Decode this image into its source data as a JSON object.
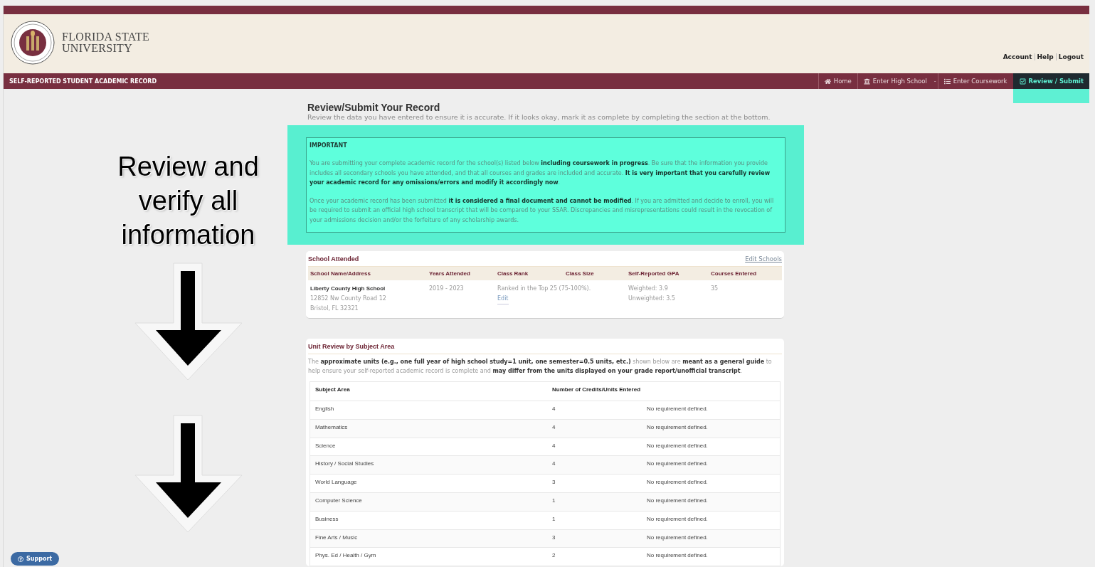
{
  "header": {
    "university_name": [
      "FLORIDA STATE",
      "UNIVERSITY"
    ],
    "user_links": [
      "Account",
      "Help",
      "Logout"
    ]
  },
  "nav": {
    "title": "SELF-REPORTED STUDENT ACADEMIC RECORD",
    "items": [
      {
        "kind": "tab",
        "label": "Home",
        "selected": false
      },
      {
        "kind": "tab",
        "label": "Enter High School",
        "selected": false
      },
      {
        "kind": "separator",
        "label": "-"
      },
      {
        "kind": "tab",
        "label": "Enter Coursework",
        "selected": false
      },
      {
        "kind": "tab",
        "label": "Review / Submit",
        "selected": true
      }
    ]
  },
  "annotation": {
    "text": "Review and verify all information"
  },
  "page": {
    "title": "Review/Submit Your Record",
    "subtitle": "Review the data you have entered to ensure it is accurate. If it looks okay, mark it as complete by completing the section at the bottom."
  },
  "important": {
    "heading": "IMPORTANT",
    "paragraphs": [
      "You are submitting your complete academic record for the school(s) listed below **including coursework in progress**. Be sure that the information you provide includes all secondary schools you have attended, and that all courses and grades are included and accurate. **It is very important that you carefully review your academic record for any omissions/errors and modify it accordingly now**.",
      "Once your academic record has been submitted **it is considered a final document and cannot be modified**. If you are admitted and decide to enroll, you will be required to submit an official high school transcript that will be compared to your SSAR. Discrepancies and misrepresentations could result in the revocation of your admissions decision and/or the forfeiture of any scholarship awards."
    ]
  },
  "school_attended": {
    "title": "School Attended",
    "edit_link": "Edit Schools",
    "columns": [
      "School Name/Address",
      "Years Attended",
      "Class Rank",
      "Class Size",
      "Self-Reported GPA",
      "Courses Entered"
    ],
    "rows": [
      {
        "name": "Liberty County High School",
        "address": [
          "12852 Nw County Road 12",
          "Bristol, FL 32321"
        ],
        "years": "2019 - 2023",
        "rank": "Ranked in the Top 25 (75-100%).",
        "rank_edit": "Edit",
        "gpa": [
          "Weighted: 3.9",
          "Unweighted: 3.5"
        ],
        "courses": "35"
      }
    ]
  },
  "unit_review": {
    "title": "Unit Review by Subject Area",
    "description": "The **approximate units (e.g., one full year of high school study=1 unit, one semester=0.5 units, etc.)** shown below are **meant as a general guide** to help ensure your self-reported academic record is complete and **may differ from the units displayed on your grade report/unofficial transcript**.",
    "columns": [
      "Subject Area",
      "Number of Credits/Units Entered"
    ],
    "rows": [
      {
        "subject": "English",
        "units": "4",
        "requirement": "No requirement defined."
      },
      {
        "subject": "Mathematics",
        "units": "4",
        "requirement": "No requirement defined."
      },
      {
        "subject": "Science",
        "units": "4",
        "requirement": "No requirement defined."
      },
      {
        "subject": "History / Social Studies",
        "units": "4",
        "requirement": "No requirement defined."
      },
      {
        "subject": "World Language",
        "units": "3",
        "requirement": "No requirement defined."
      },
      {
        "subject": "Computer Science",
        "units": "1",
        "requirement": "No requirement defined."
      },
      {
        "subject": "Business",
        "units": "1",
        "requirement": "No requirement defined."
      },
      {
        "subject": "Fine Arts / Music",
        "units": "3",
        "requirement": "No requirement defined."
      },
      {
        "subject": "Phys. Ed / Health / Gym",
        "units": "2",
        "requirement": "No requirement defined."
      }
    ]
  },
  "support_button": "Support"
}
